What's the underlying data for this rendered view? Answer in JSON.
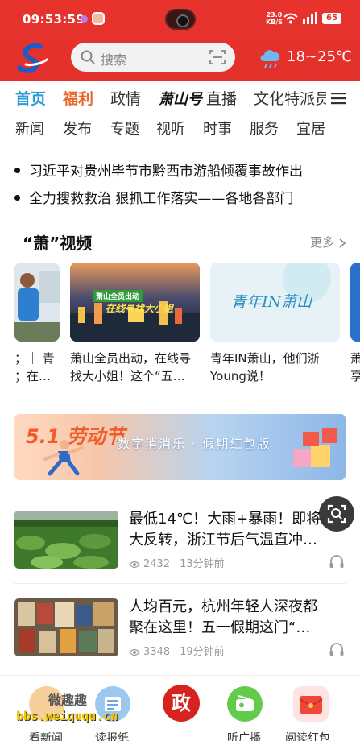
{
  "status_bar": {
    "time": "09:53:59",
    "net_speed_value": "23.0",
    "net_speed_unit": "KB/S",
    "battery": "65"
  },
  "header": {
    "search_placeholder": "搜索",
    "weather_temp": "18~25℃"
  },
  "tabs": [
    "首页",
    "福利",
    "政情",
    "萧山号",
    "直播",
    "文化特派员"
  ],
  "subtabs": [
    "新闻",
    "发布",
    "专题",
    "视听",
    "时事",
    "服务",
    "宜居"
  ],
  "headlines": [
    "习近平对贵州毕节市黔西市游船倾覆事故作出",
    "全力搜救救治 狠抓工作落实——各地各部门"
  ],
  "video_section": {
    "title": "“萧”视频",
    "more": "更多",
    "items": [
      {
        "line1": "；｜ 青",
        "line2": "；在…"
      },
      {
        "line1": "萧山全员出动，在线寻",
        "line2": "找大小姐！这个“五…",
        "thumb_text_1": "萧山全员出动",
        "thumb_text_2": "在线寻找大小姐"
      },
      {
        "line1": "青年IN萧山，他们浙",
        "line2": "Young说！",
        "thumb_text": "青年IN萧山"
      },
      {
        "line1": "萧",
        "line2": "享"
      }
    ]
  },
  "banner": {
    "badge": "5.1 劳动节",
    "text": "数字消消乐 · 假期红包版"
  },
  "news": [
    {
      "title_line1": "最低14℃！大雨+暴雨！即将",
      "title_line2": "大反转，浙江节后气温直冲…",
      "views": "2432",
      "time": "13分钟前"
    },
    {
      "title_line1": "人均百元，杭州年轻人深夜都",
      "title_line2": "聚在这里！五一假期这门“…",
      "views": "3348",
      "time": "19分钟前"
    }
  ],
  "bottom_nav": {
    "items": [
      {
        "label": "看新闻"
      },
      {
        "label": "读报纸"
      },
      {
        "label": "政",
        "center": true
      },
      {
        "label": "听广播"
      },
      {
        "label": "阅读红包"
      }
    ],
    "watermark_1": "微趣趣",
    "watermark_2": "bbs.weiququ.cn"
  },
  "colors": {
    "header_red": "#e2302b",
    "tab_active": "#2b9bd8",
    "tab_fuli": "#e8672d"
  }
}
